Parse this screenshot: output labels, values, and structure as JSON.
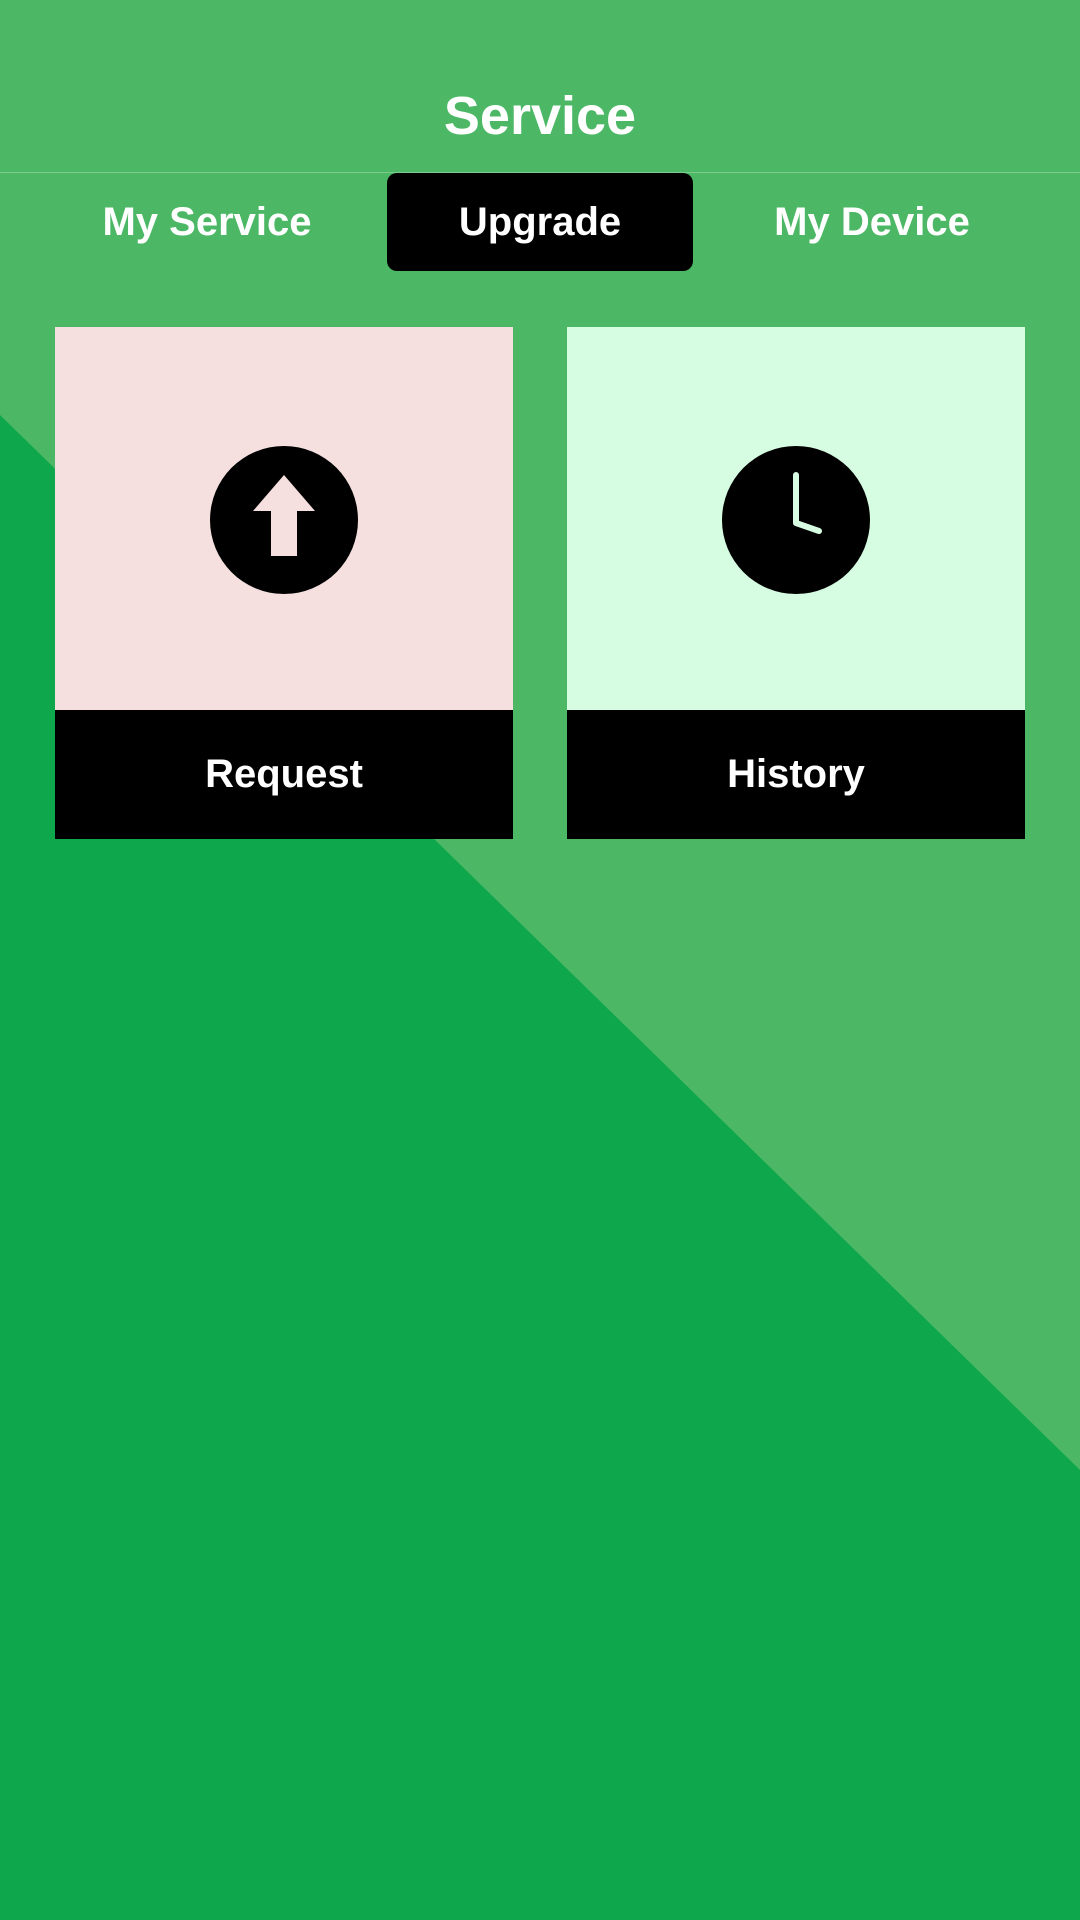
{
  "header": {
    "title": "Service"
  },
  "tabs": [
    {
      "label": "My Service",
      "selected": false
    },
    {
      "label": "Upgrade",
      "selected": true
    },
    {
      "label": "My Device",
      "selected": false
    }
  ],
  "cards": [
    {
      "label": "Request",
      "icon": "upload-arrow-icon",
      "background": "#f5e0df"
    },
    {
      "label": "History",
      "icon": "clock-icon",
      "background": "#d6fce1"
    }
  ],
  "colors": {
    "background_light": "#4cb866",
    "background_dark": "#0fa74b",
    "selected_tab": "#000000",
    "text": "#ffffff"
  }
}
